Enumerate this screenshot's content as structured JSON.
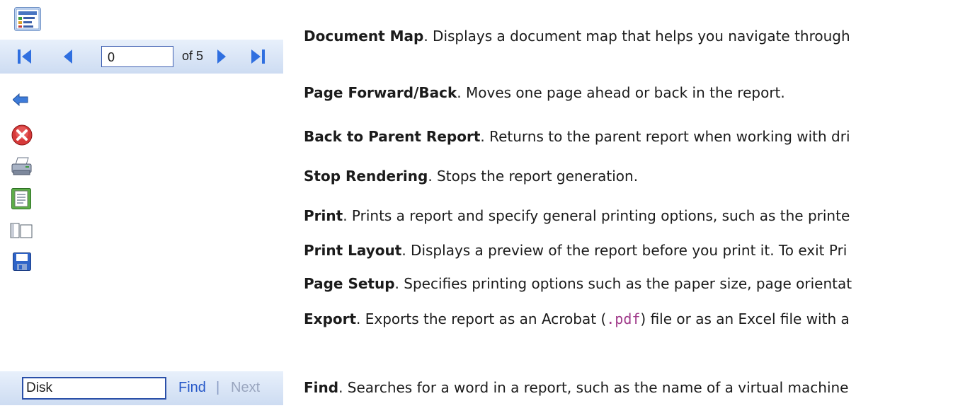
{
  "toolbar": {
    "page_value": "0",
    "of_pages": "of 5",
    "find_value": "Disk",
    "find_label": "Find",
    "separator": "|",
    "next_label": "Next"
  },
  "descriptions": [
    {
      "term": "Document Map",
      "text": ". Displays a document map that helps you navigate through"
    },
    {
      "term": "Page Forward/Back",
      "text": ". Moves one page ahead or back in the report."
    },
    {
      "term": "Back to Parent Report",
      "text": ". Returns to the parent report when working with dri"
    },
    {
      "term": "Stop Rendering",
      "text": ". Stops the report generation."
    },
    {
      "term": "Print",
      "text": ". Prints a report and specify general printing options, such as the printe"
    },
    {
      "term": "Print Layout",
      "text": ". Displays a preview of the report before you print it. To exit Pri"
    },
    {
      "term": "Page Setup",
      "text": ". Specifies printing options such as the paper size, page orientat"
    },
    {
      "term": "Export",
      "text_before": ". Exports the report as an Acrobat (",
      "code": ".pdf",
      "text_after": ") file or as an Excel file with a"
    },
    {
      "term": "Find",
      "text": ". Searches for a word in a report, such as the name of a virtual machine"
    }
  ],
  "icons": [
    "document-map-icon",
    "first-page-icon",
    "previous-page-icon",
    "next-page-icon",
    "last-page-icon",
    "back-to-parent-icon",
    "stop-rendering-icon",
    "print-icon",
    "print-layout-icon",
    "page-setup-icon",
    "export-save-icon"
  ]
}
